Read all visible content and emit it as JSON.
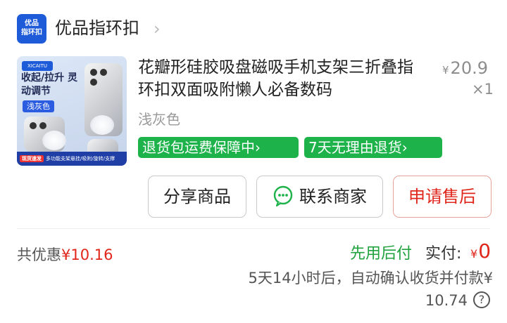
{
  "shop": {
    "logo_line1": "优品",
    "logo_line2": "指环扣",
    "name": "优品指环扣",
    "chevron": "›"
  },
  "product": {
    "image": {
      "brand": "XICAITU",
      "headline": "收起/拉升 灵动调节",
      "color_chip": "浅灰色",
      "badge": "现货速发",
      "footer": "多功能支架悬挂/吸附/旋转/支撑"
    },
    "title": "花瓣形硅胶吸盘磁吸手机支架三折叠指环扣双面吸附懒人必备数码",
    "price_symbol": "¥",
    "price": "20.9",
    "quantity": "×1",
    "variant": "浅灰色",
    "tags": [
      "退货包运费保障中›",
      "7天无理由退货›"
    ]
  },
  "actions": {
    "share": "分享商品",
    "contact": "联系商家",
    "after_sale": "申请售后"
  },
  "summary": {
    "discount_label": "共优惠",
    "discount_amount": "¥10.16",
    "pay_later": "先用后付",
    "actual_label": "实付:",
    "actual_symbol": "¥",
    "actual_value": "0",
    "confirm_note": "5天14小时后，自动确认收货并付款¥",
    "amount": "10.74",
    "help": "?"
  },
  "colors": {
    "accent_red": "#e0261b",
    "tag_green": "#1db34a",
    "pay_later_green": "#20a23e",
    "logo_blue": "#1e5bd8"
  },
  "icons": {
    "shop_logo": "shop-logo",
    "chevron": "chevron-right-icon",
    "contact": "wechat-chat-icon",
    "help": "question-circle-icon"
  }
}
